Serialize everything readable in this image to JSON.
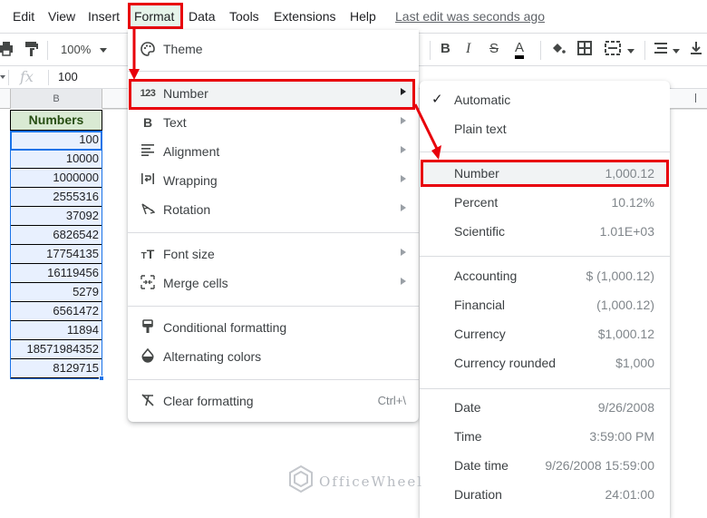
{
  "menubar": {
    "items": [
      "Edit",
      "View",
      "Insert",
      "Format",
      "Data",
      "Tools",
      "Extensions",
      "Help"
    ],
    "last_edit": "Last edit was seconds ago"
  },
  "toolbar": {
    "zoom": "100%",
    "icons": [
      "print-icon",
      "paint-format-icon",
      "bold-icon",
      "italic-icon",
      "strikethrough-icon",
      "text-color-icon",
      "fill-color-icon",
      "borders-icon",
      "merge-icon",
      "align-icon",
      "valign-icon"
    ],
    "bold": "B",
    "italic": "I",
    "strike": "S",
    "text_color": "A"
  },
  "formula_bar": {
    "fx": "fx",
    "value": "100"
  },
  "grid": {
    "column_header": "B",
    "header": "Numbers",
    "values": [
      "100",
      "10000",
      "1000000",
      "2555316",
      "37092",
      "6826542",
      "17754135",
      "16119456",
      "5279",
      "6561472",
      "11894",
      "18571984352",
      "8129715"
    ]
  },
  "format_menu": {
    "items": [
      {
        "label": "Theme",
        "icon": "palette-icon",
        "submenu": false
      },
      {
        "label": "Number",
        "icon": "123-icon",
        "submenu": true
      },
      {
        "label": "Text",
        "icon": "bold-icon",
        "submenu": true
      },
      {
        "label": "Alignment",
        "icon": "align-left-icon",
        "submenu": true
      },
      {
        "label": "Wrapping",
        "icon": "wrap-icon",
        "submenu": true
      },
      {
        "label": "Rotation",
        "icon": "rotation-icon",
        "submenu": true
      },
      {
        "label": "Font size",
        "icon": "font-size-icon",
        "submenu": true
      },
      {
        "label": "Merge cells",
        "icon": "merge-cells-icon",
        "submenu": true
      },
      {
        "label": "Conditional formatting",
        "icon": "paint-roller-icon",
        "submenu": false
      },
      {
        "label": "Alternating colors",
        "icon": "color-drop-icon",
        "submenu": false
      },
      {
        "label": "Clear formatting",
        "icon": "clear-format-icon",
        "submenu": false,
        "shortcut": "Ctrl+\\"
      }
    ]
  },
  "number_menu": {
    "items": [
      {
        "label": "Automatic",
        "example": "",
        "checked": true
      },
      {
        "label": "Plain text",
        "example": ""
      },
      {
        "label": "Number",
        "example": "1,000.12"
      },
      {
        "label": "Percent",
        "example": "10.12%"
      },
      {
        "label": "Scientific",
        "example": "1.01E+03"
      },
      {
        "label": "Accounting",
        "example": "$ (1,000.12)"
      },
      {
        "label": "Financial",
        "example": "(1,000.12)"
      },
      {
        "label": "Currency",
        "example": "$1,000.12"
      },
      {
        "label": "Currency rounded",
        "example": "$1,000"
      },
      {
        "label": "Date",
        "example": "9/26/2008"
      },
      {
        "label": "Time",
        "example": "3:59:00 PM"
      },
      {
        "label": "Date time",
        "example": "9/26/2008 15:59:00"
      },
      {
        "label": "Duration",
        "example": "24:01:00"
      }
    ]
  },
  "watermark": "OfficeWheel",
  "colors": {
    "annotation_red": "#e8000b",
    "selection_blue": "#1a73e8",
    "header_fill": "#d9ead3",
    "header_text": "#274e13"
  }
}
